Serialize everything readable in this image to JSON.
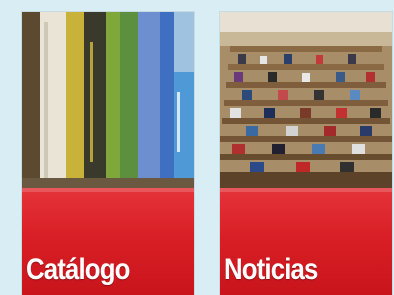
{
  "tiles": [
    {
      "label": "Catálogo",
      "accent": "#d91f26"
    },
    {
      "label": "Noticias",
      "accent": "#d91f26"
    }
  ]
}
